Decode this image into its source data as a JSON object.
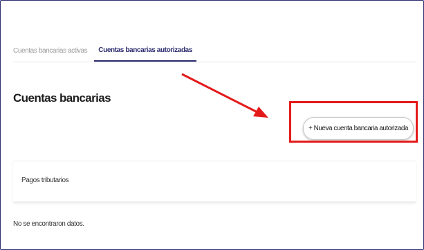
{
  "tabs": [
    {
      "label": "Cuentas bancarias activas",
      "active": false
    },
    {
      "label": "Cuentas bancarias autorizadas",
      "active": true
    }
  ],
  "section": {
    "title": "Cuentas bancarias"
  },
  "actions": {
    "new_account_label": "+ Nueva cuenta bancaria autorizada"
  },
  "list": {
    "group_label": "Pagos tributarios",
    "empty_message": "No se encontraron datos."
  },
  "colors": {
    "accent": "#2d2c6e",
    "annotation": "#e41a1a"
  }
}
